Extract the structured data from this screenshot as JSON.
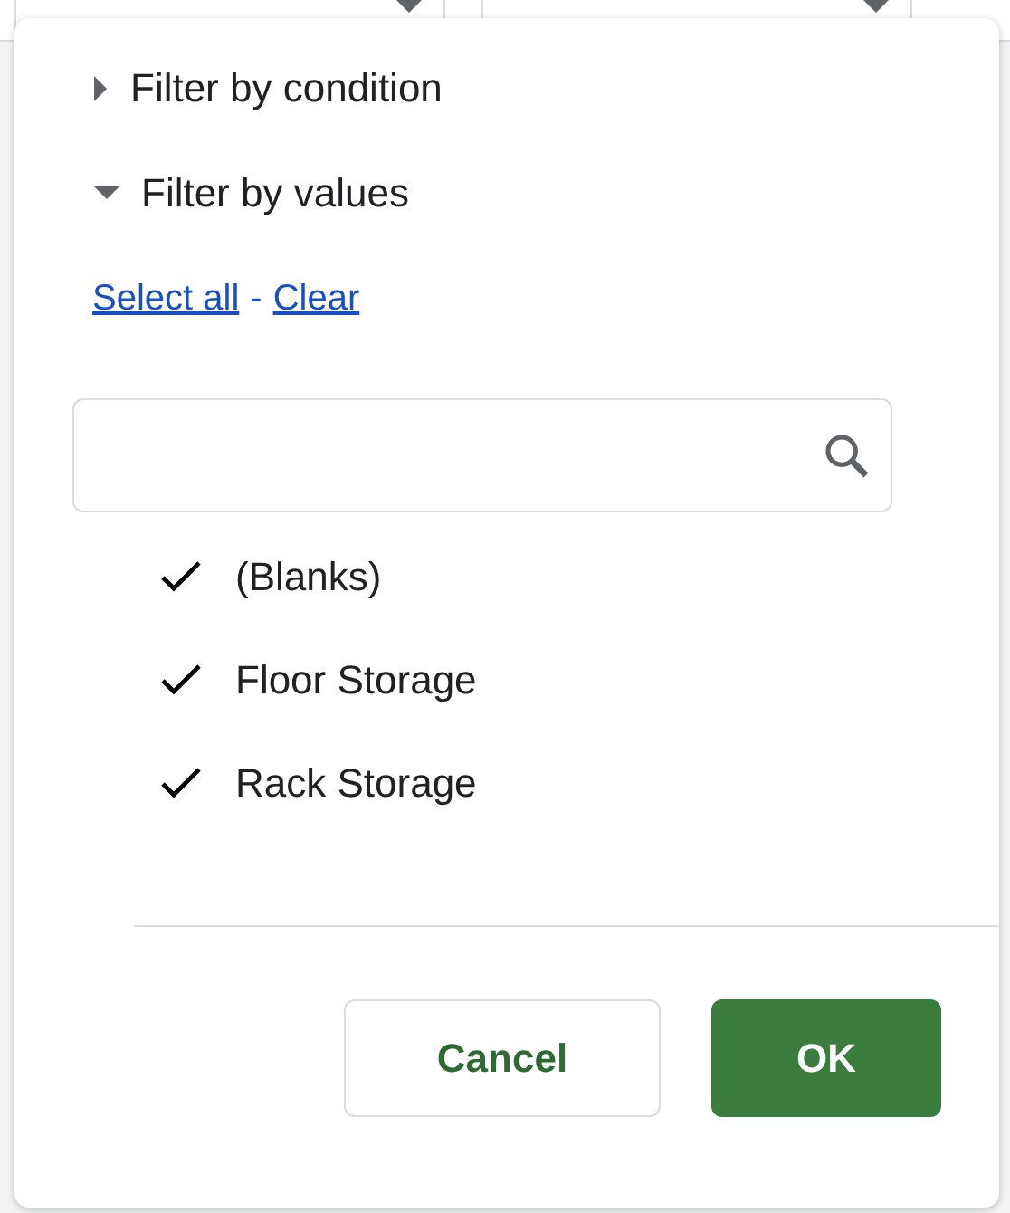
{
  "sections": [
    {
      "label": "Filter by condition",
      "expanded": false
    },
    {
      "label": "Filter by values",
      "expanded": true
    }
  ],
  "links": {
    "select_all": "Select all",
    "separator": "-",
    "clear": "Clear"
  },
  "values": [
    {
      "label": "(Blanks)",
      "checked": true
    },
    {
      "label": "Floor Storage",
      "checked": true
    },
    {
      "label": "Rack Storage",
      "checked": true
    }
  ],
  "buttons": [
    {
      "label": "Cancel",
      "kind": "secondary"
    },
    {
      "label": "OK",
      "kind": "primary"
    }
  ]
}
